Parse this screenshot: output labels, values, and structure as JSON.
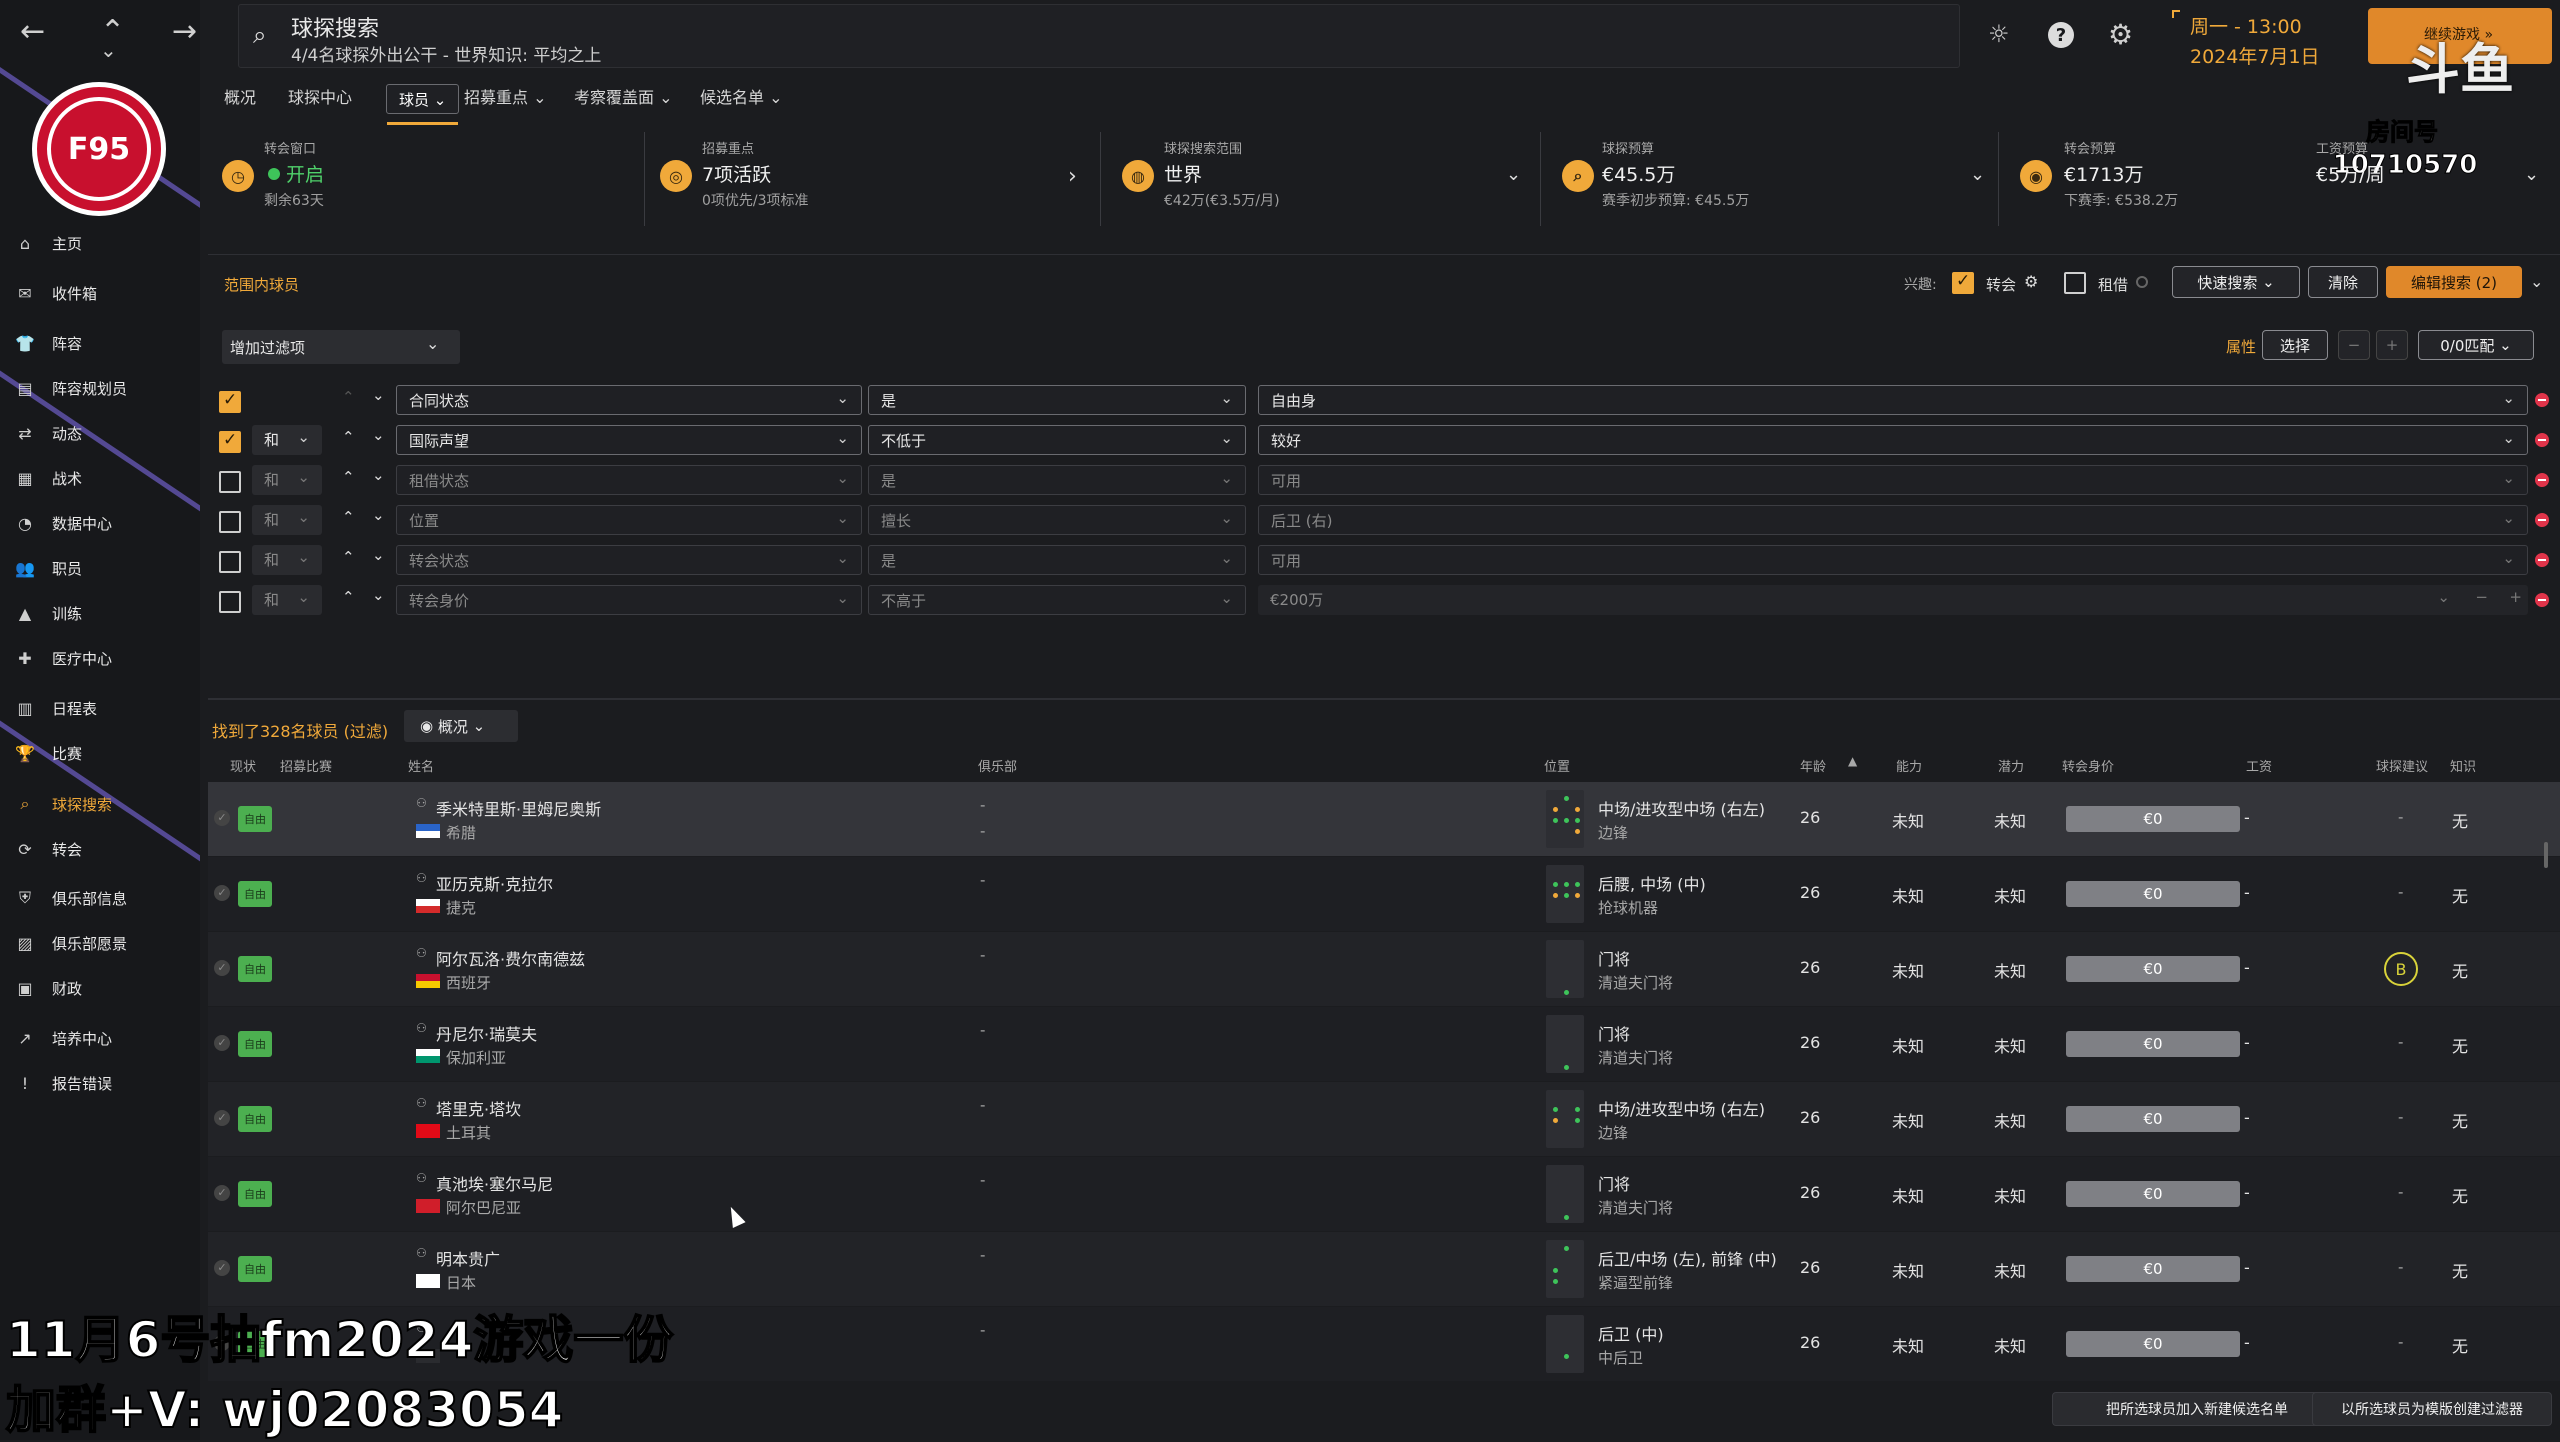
{
  "search": {
    "title": "球探搜索",
    "subtitle": "4/4名球探外出公干 - 世界知识: 平均之上"
  },
  "header": {
    "day": "周一 - 13:00",
    "date": "2024年7月1日",
    "continue": "继续游戏 »",
    "room": "房间号",
    "room_id": "10710570"
  },
  "tabs": [
    {
      "label": "概况"
    },
    {
      "label": "球探中心"
    },
    {
      "label": "球员 ⌄"
    },
    {
      "label": "招募重点 ⌄"
    },
    {
      "label": "考察覆盖面 ⌄"
    },
    {
      "label": "候选名单 ⌄"
    }
  ],
  "cards": {
    "window": {
      "label": "转会窗口",
      "value": "开启",
      "sub": "剩余63天"
    },
    "focus": {
      "label": "招募重点",
      "value": "7项活跃",
      "sub": "0项优先/3项标准"
    },
    "range": {
      "label": "球探搜索范围",
      "value": "世界",
      "sub": "€42万(€3.5万/月)"
    },
    "budget": {
      "label": "球探预算",
      "value": "€45.5万",
      "sub": "赛季初步预算: €45.5万"
    },
    "transfer": {
      "label": "转会预算",
      "value": "€1713万",
      "sub": "下赛季: €538.2万"
    },
    "wage": {
      "label": "工资预算",
      "value": "€5万/周"
    }
  },
  "sidebar": {
    "items": [
      {
        "label": "主页",
        "icon": "⌂"
      },
      {
        "label": "收件箱",
        "icon": "✉"
      },
      {
        "label": "阵容",
        "icon": "👕"
      },
      {
        "label": "阵容规划员",
        "icon": "▤"
      },
      {
        "label": "动态",
        "icon": "⇄"
      },
      {
        "label": "战术",
        "icon": "▦"
      },
      {
        "label": "数据中心",
        "icon": "◔"
      },
      {
        "label": "职员",
        "icon": "👥"
      },
      {
        "label": "训练",
        "icon": "▲"
      },
      {
        "label": "医疗中心",
        "icon": "✚"
      },
      {
        "label": "日程表",
        "icon": "▥"
      },
      {
        "label": "比赛",
        "icon": "🏆"
      },
      {
        "label": "球探搜索",
        "icon": "⌕"
      },
      {
        "label": "转会",
        "icon": "⟳"
      },
      {
        "label": "俱乐部信息",
        "icon": "⛨"
      },
      {
        "label": "俱乐部愿景",
        "icon": "▨"
      },
      {
        "label": "财政",
        "icon": "▣"
      },
      {
        "label": "培养中心",
        "icon": "↗"
      },
      {
        "label": "报告错误",
        "icon": "!"
      }
    ],
    "crest_text": "F95"
  },
  "filters": {
    "section_title": "范围内球员",
    "interest_label": "兴趣:",
    "transfer_label": "转会",
    "loan_label": "租借",
    "quick_search": "快速搜索",
    "clear": "清除",
    "edit_search": "编辑搜索 (2)",
    "add_filter": "增加过滤项",
    "attr_label": "属性",
    "choose": "选择",
    "match": "0/0匹配",
    "rows": [
      {
        "and": "",
        "field": "合同状态",
        "op": "是",
        "value": "自由身"
      },
      {
        "and": "和",
        "field": "国际声望",
        "op": "不低于",
        "value": "较好"
      },
      {
        "and": "和",
        "field": "租借状态",
        "op": "是",
        "value": "可用"
      },
      {
        "and": "和",
        "field": "位置",
        "op": "擅长",
        "value": "后卫 (右)"
      },
      {
        "and": "和",
        "field": "转会状态",
        "op": "是",
        "value": "可用"
      },
      {
        "and": "和",
        "field": "转会身价",
        "op": "不高于",
        "value": "€200万"
      }
    ]
  },
  "results": {
    "found": "找到了328名球员 (过滤)",
    "view": "概况",
    "columns": {
      "status": "现状",
      "recruit": "招募比赛",
      "name": "姓名",
      "club": "俱乐部",
      "position": "位置",
      "age": "年龄",
      "ability": "能力",
      "potential": "潜力",
      "value": "转会身价",
      "wage": "工资",
      "rec": "球探建议",
      "knowledge": "知识"
    },
    "rows": [
      {
        "status": "自由",
        "name": "季米特里斯·里姆尼奥斯",
        "nation": "希腊",
        "club": "-",
        "club2": "-",
        "pos": "中场/进攻型中场 (右左)",
        "role": "边锋",
        "age": "26",
        "ability": "未知",
        "potential": "未知",
        "fee": "€0",
        "wage": "-",
        "rec": "-",
        "know": "无"
      },
      {
        "status": "自由",
        "name": "亚历克斯·克拉尔",
        "nation": "捷克",
        "club": "-",
        "club2": "",
        "pos": "后腰, 中场 (中)",
        "role": "抢球机器",
        "age": "26",
        "ability": "未知",
        "potential": "未知",
        "fee": "€0",
        "wage": "-",
        "rec": "-",
        "know": "无"
      },
      {
        "status": "自由",
        "name": "阿尔瓦洛·费尔南德兹",
        "nation": "西班牙",
        "club": "-",
        "club2": "",
        "pos": "门将",
        "role": "清道夫门将",
        "age": "26",
        "ability": "未知",
        "potential": "未知",
        "fee": "€0",
        "wage": "-",
        "rec": "B",
        "know": "无"
      },
      {
        "status": "自由",
        "name": "丹尼尔·瑞莫夫",
        "nation": "保加利亚",
        "club": "-",
        "club2": "",
        "pos": "门将",
        "role": "清道夫门将",
        "age": "26",
        "ability": "未知",
        "potential": "未知",
        "fee": "€0",
        "wage": "-",
        "rec": "-",
        "know": "无"
      },
      {
        "status": "自由",
        "name": "塔里克·塔坎",
        "nation": "土耳其",
        "club": "-",
        "club2": "",
        "pos": "中场/进攻型中场 (右左)",
        "role": "边锋",
        "age": "26",
        "ability": "未知",
        "potential": "未知",
        "fee": "€0",
        "wage": "-",
        "rec": "-",
        "know": "无"
      },
      {
        "status": "自由",
        "name": "真池埃·塞尔马尼",
        "nation": "阿尔巴尼亚",
        "club": "-",
        "club2": "",
        "pos": "门将",
        "role": "清道夫门将",
        "age": "26",
        "ability": "未知",
        "potential": "未知",
        "fee": "€0",
        "wage": "-",
        "rec": "-",
        "know": "无"
      },
      {
        "status": "自由",
        "name": "明本贵广",
        "nation": "日本",
        "club": "-",
        "club2": "",
        "pos": "后卫/中场 (左), 前锋 (中)",
        "role": "紧逼型前锋",
        "age": "26",
        "ability": "未知",
        "potential": "未知",
        "fee": "€0",
        "wage": "-",
        "rec": "-",
        "know": "无"
      },
      {
        "status": "自由",
        "name": "",
        "nation": "",
        "club": "-",
        "club2": "",
        "pos": "后卫 (中)",
        "role": "中后卫",
        "age": "26",
        "ability": "未知",
        "potential": "未知",
        "fee": "€0",
        "wage": "-",
        "rec": "-",
        "know": "无"
      }
    ]
  },
  "footer": {
    "add_shortlist": "把所选球员加入新建候选名单",
    "create_filter": "以所选球员为模版创建过滤器"
  },
  "overlay": {
    "line1": "11月6号抽fm2024游戏一份",
    "line2": "加群+V: wj02083054"
  }
}
